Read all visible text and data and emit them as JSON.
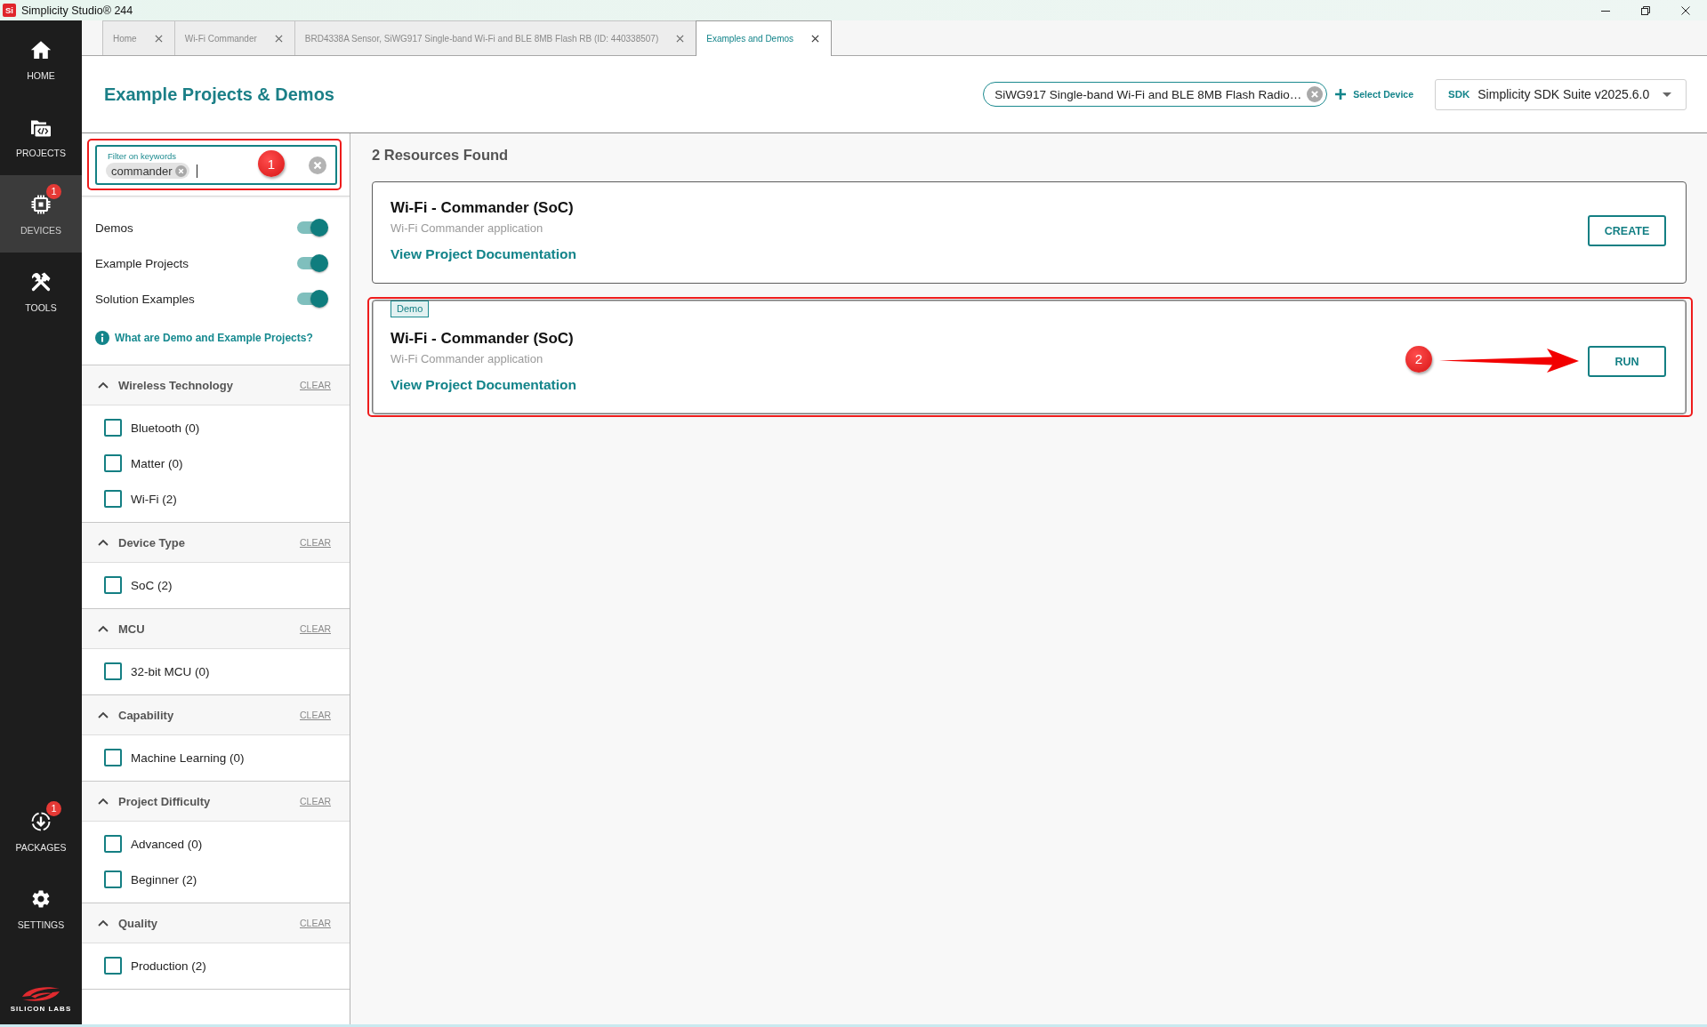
{
  "window": {
    "app_icon": "Si",
    "title": "Simplicity Studio® 244"
  },
  "nav": {
    "items": [
      {
        "label": "HOME",
        "selected": false
      },
      {
        "label": "PROJECTS",
        "selected": false
      },
      {
        "label": "DEVICES",
        "selected": true,
        "badge": "1"
      },
      {
        "label": "TOOLS",
        "selected": false
      }
    ],
    "bottom_items": [
      {
        "label": "PACKAGES",
        "selected": false,
        "badge": "1"
      },
      {
        "label": "SETTINGS",
        "selected": false
      }
    ],
    "logo_text": "SILICON LABS"
  },
  "tabs": [
    {
      "label": "Home",
      "selected": false
    },
    {
      "label": "Wi-Fi Commander",
      "selected": false
    },
    {
      "label": "BRD4338A Sensor, SiWG917 Single-band Wi-Fi and BLE 8MB Flash RB (ID: 440338507)",
      "selected": false
    },
    {
      "label": "Examples and Demos",
      "selected": true
    }
  ],
  "header": {
    "title": "Example Projects & Demos",
    "device_chip": "SiWG917 Single-band Wi-Fi and BLE 8MB Flash Radio…",
    "select_device": "Select Device",
    "sdk": {
      "prefix": "SDK",
      "value": "Simplicity SDK Suite v2025.6.0"
    }
  },
  "filters": {
    "keyword": {
      "label": "Filter on keywords",
      "chips": [
        "commander"
      ],
      "focused": true,
      "callout": {
        "kind": "badge",
        "label": "1"
      }
    },
    "toggles": [
      {
        "label": "Demos",
        "on": true
      },
      {
        "label": "Example Projects",
        "on": true
      },
      {
        "label": "Solution Examples",
        "on": true
      }
    ],
    "help_link": "What are Demo and Example Projects?",
    "groups": [
      {
        "title": "Wireless Technology",
        "expanded": true,
        "clear": "CLEAR",
        "options": [
          {
            "label": "Bluetooth (0)",
            "checked": false
          },
          {
            "label": "Matter (0)",
            "checked": false
          },
          {
            "label": "Wi-Fi (2)",
            "checked": false
          }
        ]
      },
      {
        "title": "Device Type",
        "expanded": true,
        "clear": "CLEAR",
        "options": [
          {
            "label": "SoC (2)",
            "checked": false
          }
        ]
      },
      {
        "title": "MCU",
        "expanded": true,
        "clear": "CLEAR",
        "options": [
          {
            "label": "32-bit MCU (0)",
            "checked": false
          }
        ]
      },
      {
        "title": "Capability",
        "expanded": true,
        "clear": "CLEAR",
        "options": [
          {
            "label": "Machine Learning (0)",
            "checked": false
          }
        ]
      },
      {
        "title": "Project Difficulty",
        "expanded": true,
        "clear": "CLEAR",
        "options": [
          {
            "label": "Advanced (0)",
            "checked": false
          },
          {
            "label": "Beginner (2)",
            "checked": false
          }
        ]
      },
      {
        "title": "Quality",
        "expanded": true,
        "clear": "CLEAR",
        "options": [
          {
            "label": "Production (2)",
            "checked": false
          }
        ]
      }
    ]
  },
  "results": {
    "count": "2 Resources Found",
    "cards": [
      {
        "title": "Wi-Fi - Commander (SoC)",
        "description": "Wi-Fi Commander application",
        "link": "View Project Documentation",
        "action": "CREATE"
      },
      {
        "tag": "Demo",
        "title": "Wi-Fi - Commander (SoC)",
        "description": "Wi-Fi Commander application",
        "link": "View Project Documentation",
        "action": "RUN",
        "callout": {
          "kind": "arrow",
          "label": "2"
        }
      }
    ]
  }
}
